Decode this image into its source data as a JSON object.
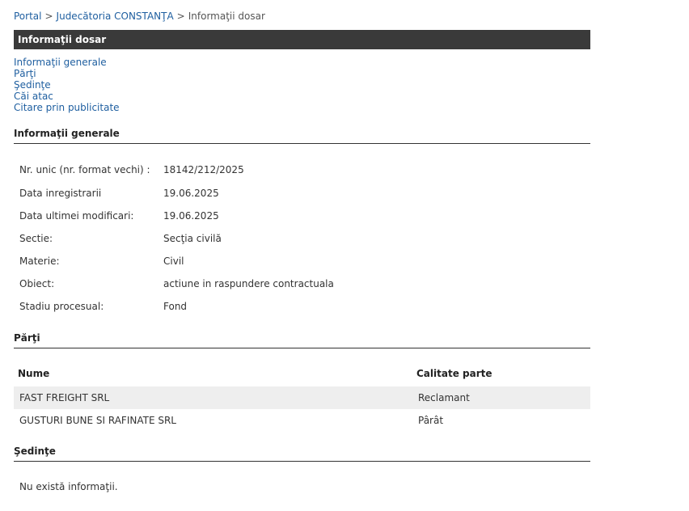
{
  "breadcrumb": {
    "portal": "Portal",
    "court": "Judecătoria CONSTANŢA",
    "current": "Informaţii dosar",
    "separator": ">"
  },
  "title": "Informaţii dosar",
  "toc": [
    "Informaţii generale",
    "Părţi",
    "Şedinţe",
    "Căi atac",
    "Citare prin publicitate"
  ],
  "general": {
    "heading": "Informaţii generale",
    "rows": [
      {
        "label": "Nr. unic (nr. format vechi) :",
        "value": "18142/212/2025"
      },
      {
        "label": "Data inregistrarii",
        "value": "19.06.2025"
      },
      {
        "label": "Data ultimei modificari:",
        "value": "19.06.2025"
      },
      {
        "label": "Sectie:",
        "value": "Secţia civilă"
      },
      {
        "label": "Materie:",
        "value": "Civil"
      },
      {
        "label": "Obiect:",
        "value": "actiune in raspundere contractuala"
      },
      {
        "label": "Stadiu procesual:",
        "value": "Fond"
      }
    ]
  },
  "parties": {
    "heading": "Părţi",
    "col_name": "Nume",
    "col_role": "Calitate parte",
    "rows": [
      {
        "name": "FAST FREIGHT SRL",
        "role": "Reclamant"
      },
      {
        "name": "GUSTURI BUNE SI RAFINATE SRL",
        "role": "Pârât"
      }
    ]
  },
  "hearings": {
    "heading": "Şedinţe",
    "empty": "Nu există informaţii."
  }
}
